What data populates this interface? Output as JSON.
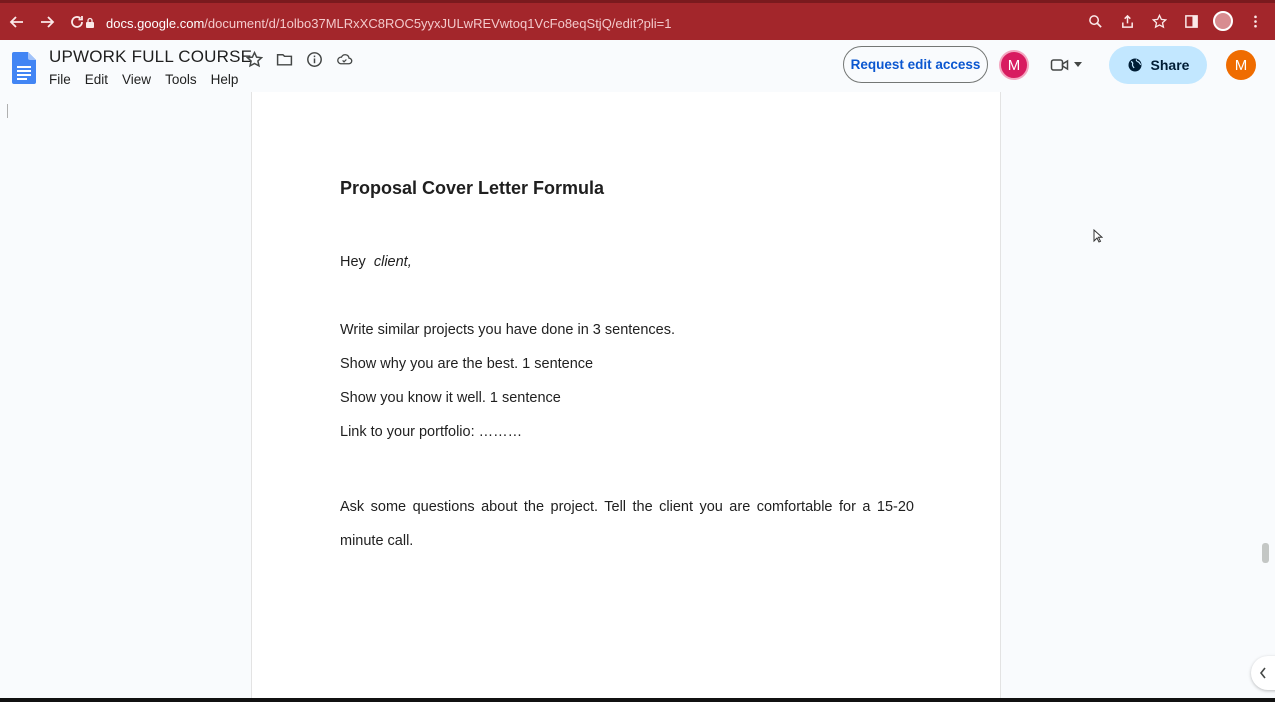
{
  "browser": {
    "url_domain": "docs.google.com",
    "url_path": "/document/d/1olbo37MLRxXC8ROC5yyxJULwREVwtoq1VcFo8eqStjQ/edit?pli=1"
  },
  "docs": {
    "title": "UPWORK FULL COURSE",
    "menu": [
      "File",
      "Edit",
      "View",
      "Tools",
      "Help"
    ],
    "request_edit_label": "Request edit access",
    "share_label": "Share",
    "avatar_initial_1": "M",
    "avatar_initial_2": "M"
  },
  "document": {
    "heading": "Proposal Cover Letter Formula",
    "greeting_prefix": "Hey",
    "greeting_name": "client,",
    "lines": [
      "Write similar projects you have done in 3 sentences.",
      "Show why you are the best. 1 sentence",
      "Show you know it well. 1 sentence",
      "Link to your portfolio: ………"
    ],
    "closing": "Ask some questions about the project. Tell the client you are comfortable for a 15-20 minute call."
  },
  "colors": {
    "browser_bar": "#a3262b",
    "share_bg": "#c2e7ff",
    "avatar_pink": "#d81b60",
    "avatar_orange": "#ef6c00",
    "link_blue": "#0b57d0"
  }
}
